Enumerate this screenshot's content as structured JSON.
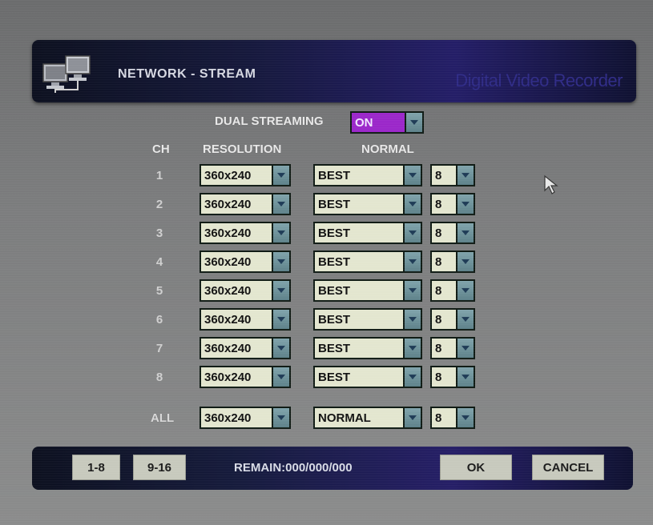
{
  "header": {
    "title": "NETWORK - STREAM",
    "brand": "Digital Video Recorder"
  },
  "dual_streaming": {
    "label": "DUAL STREAMING",
    "value": "ON"
  },
  "columns": {
    "ch": "CH",
    "resolution": "RESOLUTION",
    "normal": "NORMAL"
  },
  "rows": [
    {
      "ch": "1",
      "resolution": "360x240",
      "quality": "BEST",
      "fps": "8"
    },
    {
      "ch": "2",
      "resolution": "360x240",
      "quality": "BEST",
      "fps": "8"
    },
    {
      "ch": "3",
      "resolution": "360x240",
      "quality": "BEST",
      "fps": "8"
    },
    {
      "ch": "4",
      "resolution": "360x240",
      "quality": "BEST",
      "fps": "8"
    },
    {
      "ch": "5",
      "resolution": "360x240",
      "quality": "BEST",
      "fps": "8"
    },
    {
      "ch": "6",
      "resolution": "360x240",
      "quality": "BEST",
      "fps": "8"
    },
    {
      "ch": "7",
      "resolution": "360x240",
      "quality": "BEST",
      "fps": "8"
    },
    {
      "ch": "8",
      "resolution": "360x240",
      "quality": "BEST",
      "fps": "8"
    }
  ],
  "all": {
    "label": "ALL",
    "resolution": "360x240",
    "quality": "NORMAL",
    "fps": "8"
  },
  "footer": {
    "page1": "1-8",
    "page2": "9-16",
    "remain": "REMAIN:000/000/000",
    "ok": "OK",
    "cancel": "CANCEL"
  },
  "colors": {
    "dual_on": "#9a26c9",
    "dropdown_bg": "#e3e6cf",
    "dropdown_btn": "#6e929a",
    "header_bg": "#221c66"
  },
  "icons": {
    "header": "network-computers-icon",
    "pointer": "mouse-pointer-icon",
    "dropdown": "chevron-down-icon"
  }
}
